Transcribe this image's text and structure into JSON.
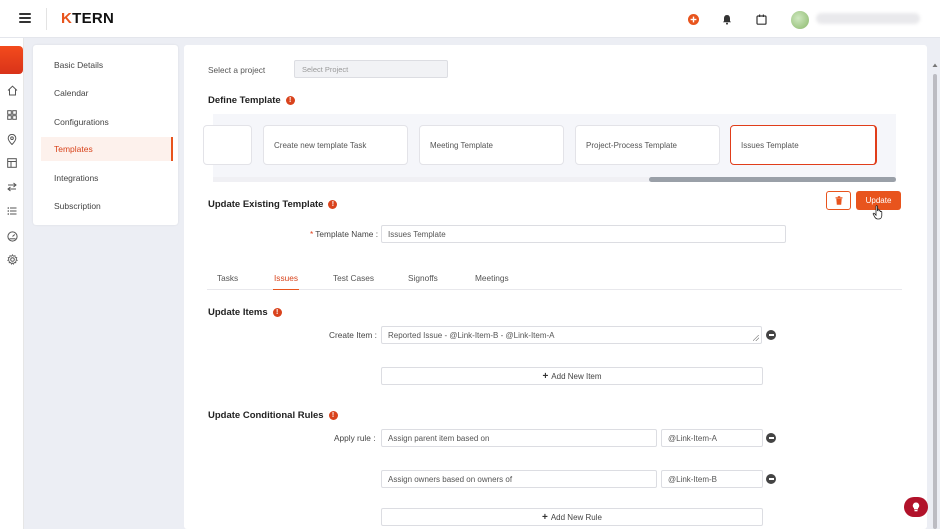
{
  "app": {
    "logo_mark": "K",
    "logo_rest": "TERN"
  },
  "header": {
    "icons": [
      "add-circle-icon",
      "bell-icon",
      "calendar-icon"
    ],
    "accent": "#e8541d"
  },
  "rail": {
    "icons": [
      "home-icon",
      "grid-icon",
      "location-icon",
      "board-icon",
      "transfer-icon",
      "list-icon",
      "gauge-icon",
      "gear-icon"
    ]
  },
  "settings_menu": {
    "items": [
      {
        "label": "Basic Details"
      },
      {
        "label": "Calendar"
      },
      {
        "label": "Configurations"
      },
      {
        "label": "Templates",
        "active": true
      },
      {
        "label": "Integrations"
      },
      {
        "label": "Subscription"
      }
    ]
  },
  "project": {
    "label": "Select a project",
    "placeholder": "Select Project"
  },
  "define_template": {
    "title": "Define Template",
    "cards": [
      {
        "label": ""
      },
      {
        "label": "Create new template Task"
      },
      {
        "label": "Meeting Template"
      },
      {
        "label": "Project-Process Template"
      },
      {
        "label": "Issues Template",
        "active": true
      }
    ]
  },
  "update_existing": {
    "title": "Update Existing Template",
    "update_label": "Update",
    "name_label": "Template Name :",
    "name_value": "Issues Template"
  },
  "tabs": [
    {
      "label": "Tasks"
    },
    {
      "label": "Issues",
      "active": true
    },
    {
      "label": "Test Cases"
    },
    {
      "label": "Signoffs"
    },
    {
      "label": "Meetings"
    }
  ],
  "update_items": {
    "title": "Update Items",
    "create_label": "Create Item :",
    "create_value": "Reported Issue - @Link-Item-B - @Link-Item-A",
    "add_label": "Add New Item"
  },
  "conditional_rules": {
    "title": "Update Conditional Rules",
    "apply_label": "Apply rule :",
    "rules": [
      {
        "text": "Assign parent item based on",
        "link": "@Link-Item-A"
      },
      {
        "text": "Assign owners based on owners of",
        "link": "@Link-Item-B"
      }
    ],
    "add_label": "Add New Rule"
  }
}
